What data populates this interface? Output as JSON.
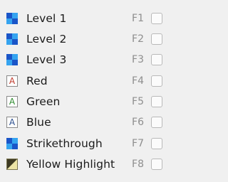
{
  "colors": {
    "level_blue_light": "#35a4f0",
    "level_blue_dark": "#1a55c8",
    "red": "#c0392b",
    "green": "#2e8b2e",
    "blue": "#2c4f8f",
    "highlight_yellow": "#ece4a6",
    "highlight_dark": "#3d3a23"
  },
  "shortcuts": [
    {
      "label": "Level 1",
      "key": "F1",
      "icon": "level-icon",
      "checked": false
    },
    {
      "label": "Level 2",
      "key": "F2",
      "icon": "level-icon",
      "checked": false
    },
    {
      "label": "Level 3",
      "key": "F3",
      "icon": "level-icon",
      "checked": false
    },
    {
      "label": "Red",
      "key": "F4",
      "icon": "red-text-icon",
      "icon_letter": "A",
      "checked": false
    },
    {
      "label": "Green",
      "key": "F5",
      "icon": "green-text-icon",
      "icon_letter": "A",
      "checked": false
    },
    {
      "label": "Blue",
      "key": "F6",
      "icon": "blue-text-icon",
      "icon_letter": "A",
      "checked": false
    },
    {
      "label": "Strikethrough",
      "key": "F7",
      "icon": "strikethrough-icon",
      "checked": false
    },
    {
      "label": "Yellow Highlight",
      "key": "F8",
      "icon": "highlight-icon",
      "checked": false
    }
  ]
}
